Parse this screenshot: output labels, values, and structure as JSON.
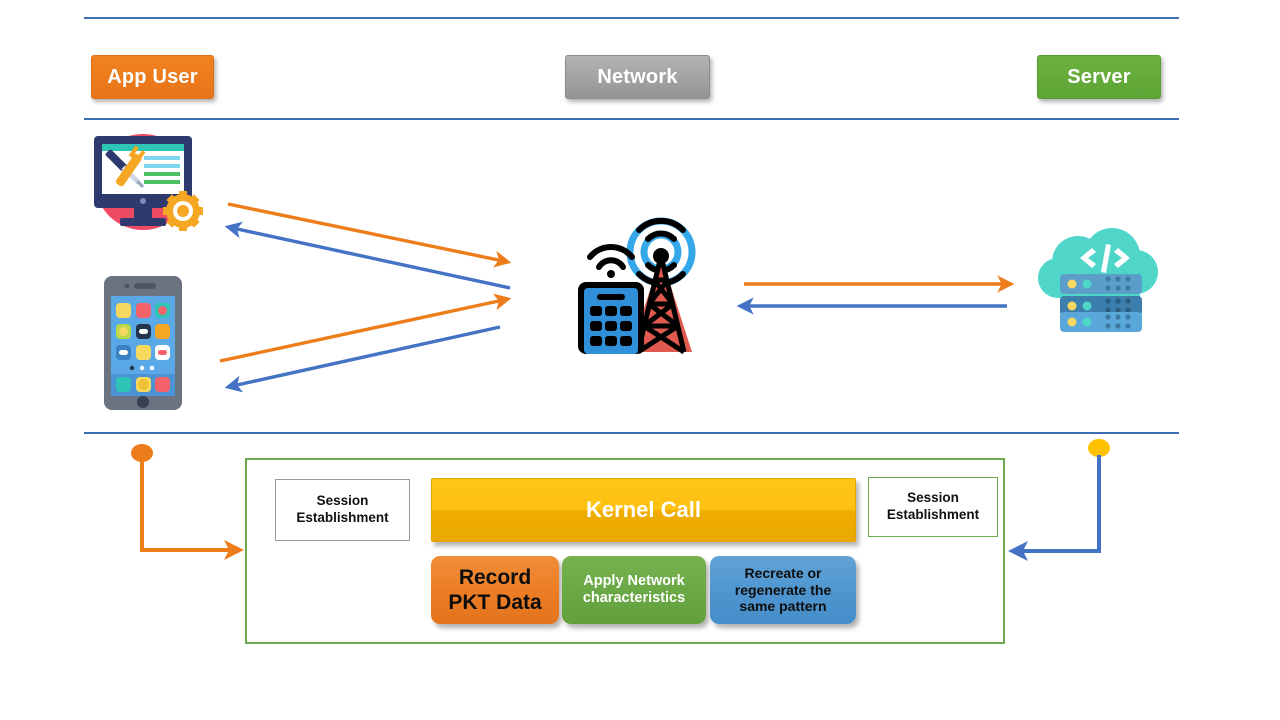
{
  "diagram": {
    "title_lane_headers": [
      {
        "id": "app-user",
        "label": "App User",
        "color": "#ed7d1a"
      },
      {
        "id": "network",
        "label": "Network",
        "color": "#9a9a9a"
      },
      {
        "id": "server",
        "label": "Server",
        "color": "#64aa37"
      }
    ],
    "icons": {
      "monitor": "desktop-computer-tools-icon",
      "phone": "smartphone-apps-icon",
      "network": "cell-tower-building-icon",
      "server": "cloud-server-code-icon"
    },
    "flows": [
      {
        "id": "monitor-to-network",
        "direction": "right",
        "color": "#ed7d1a"
      },
      {
        "id": "network-to-monitor",
        "direction": "left",
        "color": "#4472c4"
      },
      {
        "id": "phone-to-network",
        "direction": "right",
        "color": "#ed7d1a"
      },
      {
        "id": "network-to-phone",
        "direction": "left",
        "color": "#4472c4"
      },
      {
        "id": "network-to-server",
        "direction": "right",
        "color": "#ed7d1a"
      },
      {
        "id": "server-to-network",
        "direction": "left",
        "color": "#4472c4"
      }
    ],
    "entry_connectors": [
      {
        "id": "left-entry",
        "dot_color": "#ed7d1a",
        "line_color": "#ed7d1a"
      },
      {
        "id": "right-entry",
        "dot_color": "#ffc000",
        "line_color": "#4472c4"
      }
    ],
    "process": {
      "container_border_color": "#6cab4b",
      "session_left": {
        "label": "Session\nEstablishment",
        "line1": "Session",
        "line2": "Establishment"
      },
      "session_right": {
        "label": "Session\nEstablishment",
        "line1": "Session",
        "line2": "Establishment"
      },
      "kernel_call": {
        "label": "Kernel Call",
        "color": "#fdc112"
      },
      "steps": [
        {
          "id": "record",
          "line1": "Record",
          "line2": "PKT Data",
          "line3": "",
          "color": "#ec7d25"
        },
        {
          "id": "apply",
          "line1": "Apply Network",
          "line2": "characteristics",
          "line3": "",
          "color": "#6aa845"
        },
        {
          "id": "recreate",
          "line1": "Recreate or",
          "line2": "regenerate the",
          "line3": "same pattern",
          "color": "#4e95cf"
        }
      ]
    },
    "divider_color": "#3b6eb5"
  }
}
